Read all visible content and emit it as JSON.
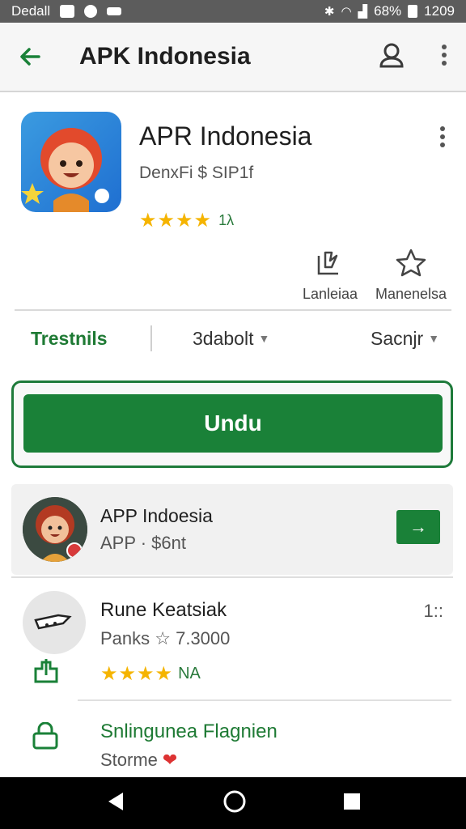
{
  "status_bar": {
    "carrier": "Dedall",
    "battery": "68%",
    "time": "1209"
  },
  "app_bar": {
    "title": "APK Indonesia"
  },
  "app": {
    "name": "APR Indonesia",
    "developer": "DenxFi $ SIP1f",
    "rating_stars": 4,
    "rating_value": "1λ",
    "actions": [
      {
        "label": "Lanleiaa",
        "icon": "share-icon"
      },
      {
        "label": "Manenelsa",
        "icon": "star-outline-icon"
      }
    ]
  },
  "tabs": {
    "tab1": "Trestnils",
    "tab2": "3dabolt",
    "tab3": "Sacnjr"
  },
  "install": {
    "label": "Undu"
  },
  "list": {
    "card": {
      "title": "APP Indoesia",
      "subtitle": "APP · $6nt",
      "action_glyph": "→"
    },
    "item2": {
      "title": "Rune Keatsiak",
      "subtitle": "Panks ☆ 7.3000",
      "stars": 4,
      "rating_label": "NA",
      "meta": "1::"
    },
    "item3": {
      "title": "Snlingunea Flagnien",
      "subtitle": "Storme"
    }
  },
  "colors": {
    "accent_green": "#1a8138",
    "star_yellow": "#f5b400",
    "status_bar": "#5c5c5c"
  }
}
